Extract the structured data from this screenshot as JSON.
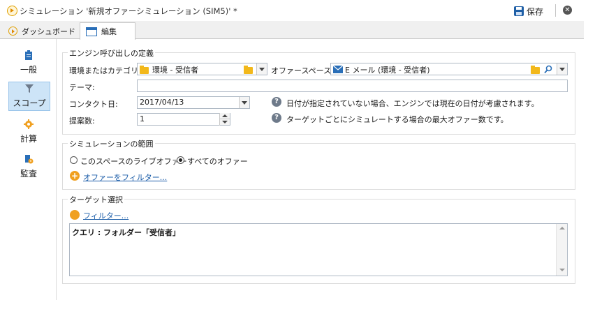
{
  "window": {
    "title": "シミュレーション '新規オファーシミュレーション (SIM5)' *",
    "save_label": "保存",
    "close_label": "✕"
  },
  "tabs": [
    {
      "label": "ダッシュボード",
      "icon": "play-icon",
      "active": false
    },
    {
      "label": "編集",
      "icon": "form-icon",
      "active": true
    }
  ],
  "nav": {
    "items": [
      {
        "label": "一般",
        "icon": "clipboard-icon",
        "active": false
      },
      {
        "label": "スコープ",
        "icon": "funnel-icon",
        "active": true
      },
      {
        "label": "計算",
        "icon": "gear-icon",
        "active": false
      },
      {
        "label": "監査",
        "icon": "audit-icon",
        "active": false
      }
    ]
  },
  "engine": {
    "title": "エンジン呼び出しの定義",
    "category_label": "環境またはカテゴリ:",
    "category_value": "環境 - 受信者",
    "space_label": "オファースペース:",
    "space_value": "E メール (環境 - 受信者)",
    "theme_label": "テーマ:",
    "theme_value": "",
    "contact_date_label": "コンタクト日:",
    "contact_date_value": "2017/04/13",
    "contact_date_help": "日付が指定されていない場合、エンジンでは現在の日付が考慮されます。",
    "proposals_label": "提案数:",
    "proposals_value": "1",
    "proposals_help": "ターゲットごとにシミュレートする場合の最大オファー数です。"
  },
  "range": {
    "title": "シミュレーションの範囲",
    "option_live": "このスペースのライブオファー",
    "option_all": "すべてのオファー",
    "selected": "all",
    "filter_link": "オファーをフィルター..."
  },
  "target": {
    "title": "ターゲット選択",
    "filter_link": "フィルター...",
    "query_text": "クエリ : フォルダー「受信者」"
  },
  "colors": {
    "accent": "#1a5ca8",
    "nav_active_bg": "#cde4f7",
    "orange": "#f0a020"
  }
}
